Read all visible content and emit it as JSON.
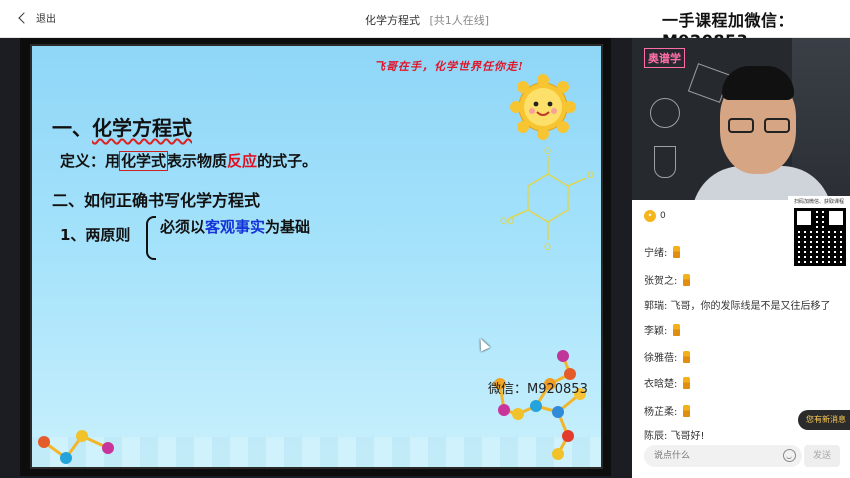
{
  "topbar": {
    "back_label": "退出",
    "title": "化学方程式",
    "online": "[共1人在线]",
    "watermark": "一手课程加微信：M920853"
  },
  "slide": {
    "motto": "飞哥在手，化学世界任你走!",
    "heading1_prefix": "一、",
    "heading1_main": "化学方程式",
    "definition": {
      "a": "定义：用",
      "b": "化学式",
      "c": "表示物质",
      "d": "反应",
      "e": "的式子。"
    },
    "heading2": "二、如何正确书写化学方程式",
    "heading3": "1、两原则",
    "rule1": {
      "a": "必须以",
      "b": "客观事实",
      "c": "为基础"
    },
    "watermark": "微信：M920853",
    "colors": {
      "red": "#e01020",
      "blue": "#1533d8"
    }
  },
  "video": {
    "board_sign": "奥谱学",
    "qr_caption": "扫码加微信、获取课程"
  },
  "coins": {
    "count": "0"
  },
  "chat": {
    "messages": [
      {
        "name": "宁绪:",
        "text": "",
        "thumb": true
      },
      {
        "name": "张贺之:",
        "text": "",
        "thumb": true
      },
      {
        "name": "郭瑞:",
        "text": " 飞哥，你的发际线是不是又往后移了",
        "thumb": false
      },
      {
        "name": "李颖:",
        "text": "",
        "thumb": true
      },
      {
        "name": "徐雅蓓:",
        "text": "",
        "thumb": true
      },
      {
        "name": "衣晗楚:",
        "text": "",
        "thumb": true
      },
      {
        "name": "杨芷柔:",
        "text": "",
        "thumb": true
      },
      {
        "name": "陈辰:",
        "text": " 飞哥好!",
        "thumb": false
      }
    ],
    "new_message_badge": "您有新消息",
    "input_placeholder": "说点什么",
    "send_label": "发送"
  }
}
